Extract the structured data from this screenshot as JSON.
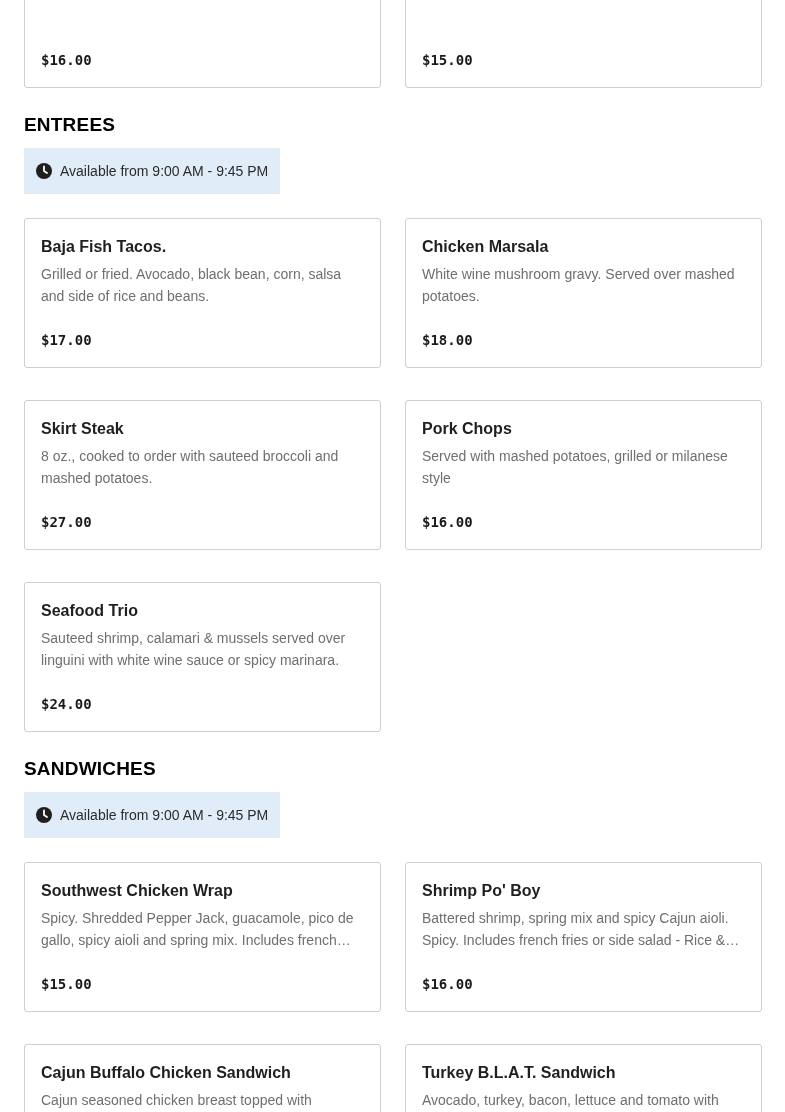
{
  "sections": [
    {
      "items": [
        {
          "price": "$16.00"
        },
        {
          "price": "$15.00"
        }
      ]
    },
    {
      "heading": "ENTREES",
      "hours": "Available from 9:00 AM - 9:45 PM",
      "items": [
        {
          "name": "Baja Fish Tacos.",
          "description": "Grilled or fried. Avocado, black bean, corn, salsa and side of rice and beans.",
          "price": "$17.00"
        },
        {
          "name": "Chicken Marsala",
          "description": "White wine mushroom gravy. Served over mashed potatoes.",
          "price": "$18.00"
        },
        {
          "name": "Skirt Steak",
          "description": "8 oz., cooked to order with sauteed broccoli and mashed potatoes.",
          "price": "$27.00"
        },
        {
          "name": "Pork Chops",
          "description": "Served with mashed potatoes, grilled or milanese style",
          "price": "$16.00"
        },
        {
          "name": "Seafood Trio",
          "description": "Sauteed shrimp, calamari & mussels served over linguini with white wine sauce or spicy marinara.",
          "price": "$24.00"
        }
      ]
    },
    {
      "heading": "SANDWICHES",
      "hours": "Available from 9:00 AM - 9:45 PM",
      "items": [
        {
          "name": "Southwest Chicken Wrap",
          "description": "Spicy. Shredded Pepper Jack, guacamole, pico de gallo, spicy aioli and spring mix. Includes french…",
          "price": "$15.00"
        },
        {
          "name": "Shrimp Po' Boy",
          "description": "Battered shrimp, spring mix and spicy Cajun aioli. Spicy. Includes french fries or side salad - Rice &…",
          "price": "$16.00"
        },
        {
          "name": "Cajun Buffalo Chicken Sandwich",
          "description": "Cajun seasoned chicken breast topped with"
        },
        {
          "name": "Turkey B.L.A.T. Sandwich",
          "description": "Avocado, turkey, bacon, lettuce and tomato with"
        }
      ]
    }
  ]
}
